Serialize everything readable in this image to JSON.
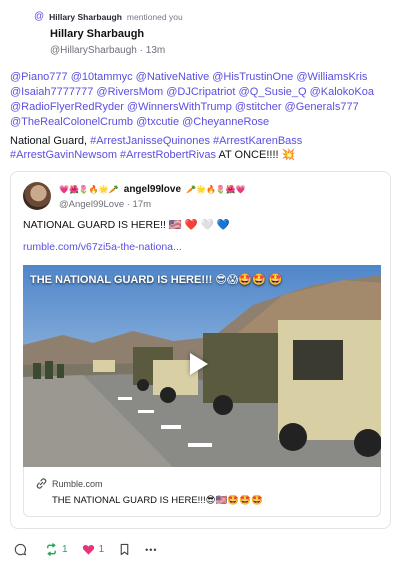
{
  "notification": {
    "at_icon": "@",
    "name": "Hillary Sharbaugh",
    "action": "mentioned you"
  },
  "author": {
    "name": "Hillary Sharbaugh",
    "handle": "@HillarySharbaugh",
    "time": "· 13m"
  },
  "mentions": "@Piano777 @10tammyc @NativeNative @HisTrustinOne @WilliamsKris @Isaiah7777777 @RiversMom @DJCripatriot @Q_Susie_Q @KalokoKoa @RadioFlyerRedRyder @WinnersWithTrump @stitcher @Generals777 @TheRealColonelCrumb @txcutie @CheyanneRose",
  "post": {
    "intro": "National Guard, ",
    "hashtags1": "#ArrestJanisseQuinones #ArrestKarenBass",
    "hashtags2": "#ArrestGavinNewsom #ArrestRobertRivas",
    "outro": " AT ONCE!!!! 💥"
  },
  "quote": {
    "emoji_pre": "💗🌺🌷🔥🌟🥕",
    "name": "angel99love",
    "emoji_post": "🥕🌟🔥🌷🌺💗",
    "handle": "@Angel99Love",
    "time": "· 17m",
    "text": "NATIONAL GUARD IS HERE!! 🇺🇸 ❤️ 🤍 💙",
    "link": "rumble.com/v67zi5a-the-nationa..."
  },
  "video": {
    "overlay_title": "THE NATIONAL GUARD IS HERE!!! 😎😱🤩🤩 🤩"
  },
  "link_preview": {
    "domain": "Rumble.com",
    "title": "THE NATIONAL GUARD IS HERE!!!😎🇺🇸🤩🤩🤩"
  },
  "actions": {
    "reply_count": "",
    "repost_count": "1",
    "like_count": "1",
    "more_label": "•••"
  },
  "colors": {
    "accent": "#5b4fe0",
    "repost": "#1da95a",
    "like": "#e8347a"
  }
}
